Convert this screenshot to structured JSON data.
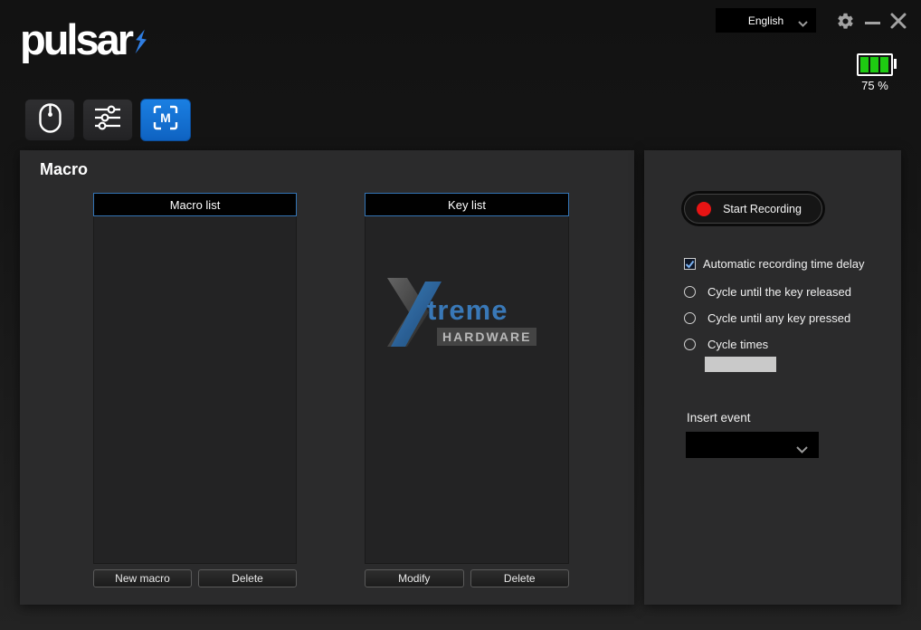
{
  "titlebar": {
    "language_selector": {
      "value": "English"
    }
  },
  "header": {
    "logo_text": "pulsar",
    "battery": {
      "percent_label": "75 %",
      "bars_filled": 3,
      "bar_color": "#1ecb12"
    }
  },
  "tabs": [
    {
      "name": "mouse",
      "active": false
    },
    {
      "name": "settings",
      "active": false
    },
    {
      "name": "macro",
      "active": true,
      "glyph": "M"
    }
  ],
  "macro_section": {
    "title": "Macro",
    "macro_list": {
      "header": "Macro list",
      "items": [],
      "buttons": {
        "new": "New macro",
        "delete": "Delete"
      }
    },
    "key_list": {
      "header": "Key list",
      "items": [],
      "buttons": {
        "modify": "Modify",
        "delete": "Delete"
      },
      "watermark": {
        "text": "treme",
        "subtext": "HARDWARE"
      }
    }
  },
  "recording_panel": {
    "start_button_label": "Start Recording",
    "auto_delay_checkbox": {
      "label": "Automatic recording time delay",
      "checked": true
    },
    "cycle_options": [
      {
        "label": "Cycle until the key released",
        "selected": false
      },
      {
        "label": "Cycle until any key pressed",
        "selected": false
      },
      {
        "label": "Cycle times",
        "selected": false
      }
    ],
    "cycle_times_input": {
      "value": ""
    },
    "insert_event": {
      "label": "Insert event",
      "value": ""
    }
  },
  "colors": {
    "accent_blue": "#1273d2",
    "list_border_blue": "#3374b5",
    "record_red": "#e81414",
    "battery_green": "#1ecb12"
  }
}
